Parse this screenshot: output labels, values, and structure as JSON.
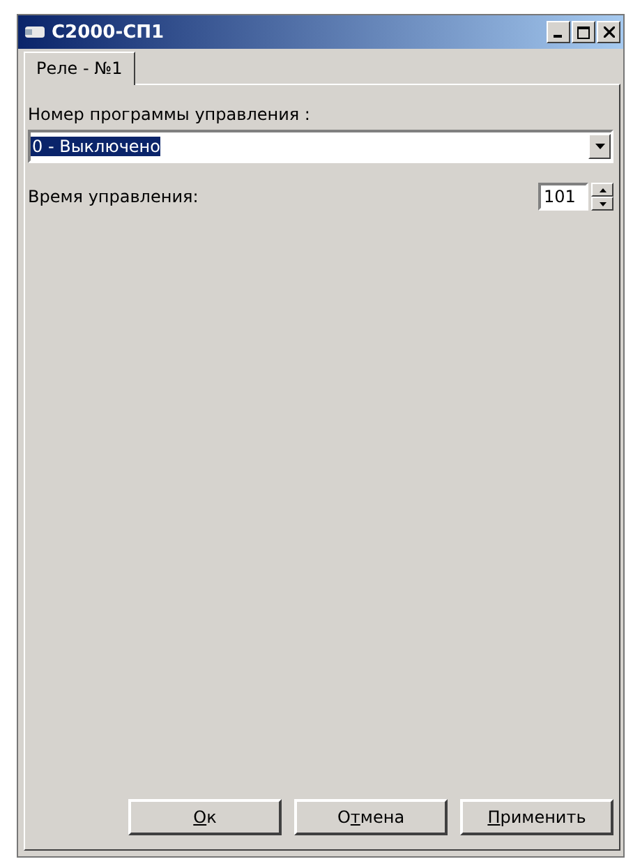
{
  "window": {
    "title": "С2000-СП1"
  },
  "tabs": [
    {
      "label": "Реле - №1",
      "selected": true
    }
  ],
  "program_field": {
    "label": "Номер программы управления :",
    "value": "0 - Выключено",
    "text_selected": true
  },
  "time_field": {
    "label": "Время управления:",
    "value": "101"
  },
  "buttons": [
    {
      "key": "О",
      "after": "к"
    },
    {
      "before": "О",
      "key": "т",
      "after": "мена"
    },
    {
      "key": "П",
      "after": "рименить"
    }
  ]
}
